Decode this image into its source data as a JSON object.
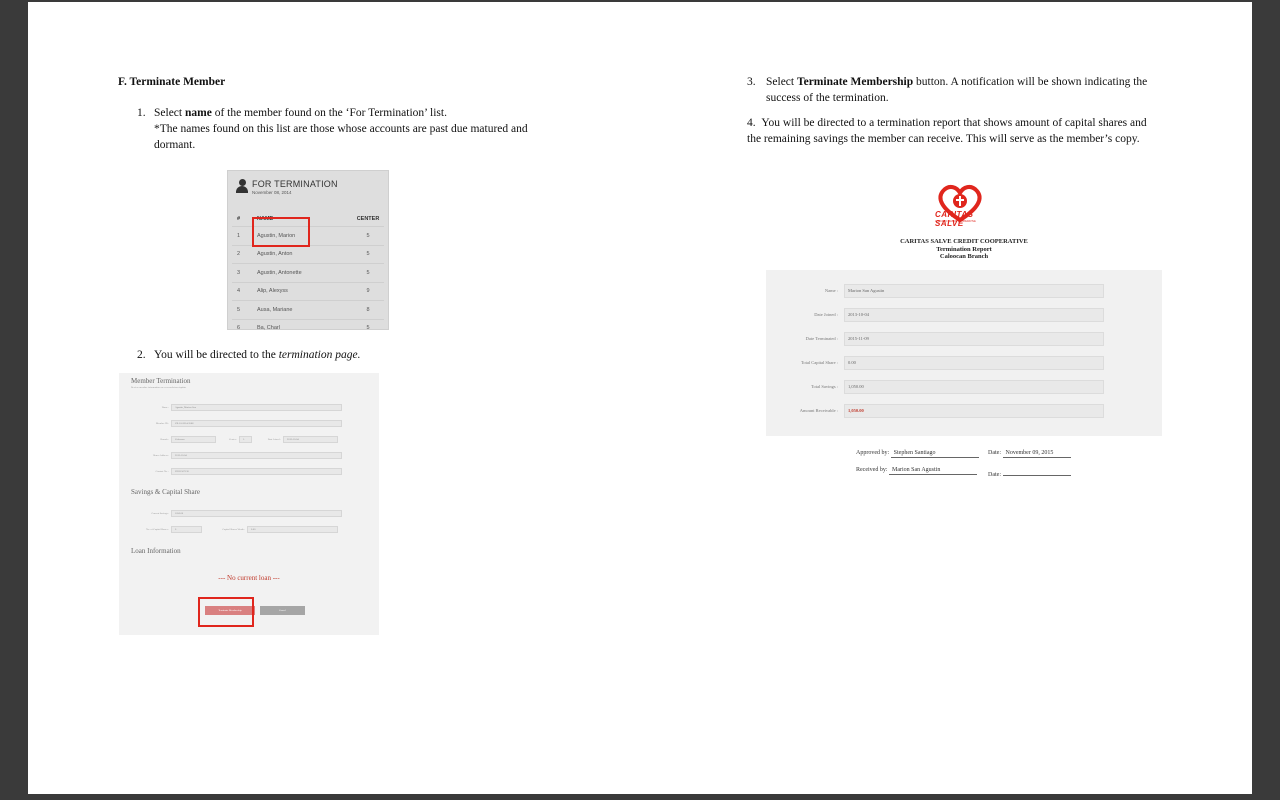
{
  "doc": {
    "section_title": "F. Terminate Member",
    "step1_prefix": "Select ",
    "step1_bold": "name",
    "step1_rest": " of the member found on the ‘For Termination’ list.",
    "step1_note": "*The names found on this list are those whose accounts are past due matured and dormant.",
    "step2_prefix": "You will be directed to the ",
    "step2_italic": "termination page.",
    "step3_prefix": "Select ",
    "step3_bold": "Terminate Membership",
    "step3_rest": " button. A notification will be shown indicating the success of the termination.",
    "step4": "You will be directed to a termination report that shows amount of capital shares and the remaining savings the member can receive. This will serve as the member’s copy.",
    "num1": "1.",
    "num2": "2.",
    "num3": "3.",
    "num4": "4."
  },
  "for_termination": {
    "title": "FOR TERMINATION",
    "date": "November 08, 2014",
    "headers": [
      "#",
      "NAME",
      "CENTER"
    ],
    "rows": [
      [
        "1",
        "Agustin, Marion",
        "5"
      ],
      [
        "2",
        "Agustin, Anton",
        "5"
      ],
      [
        "3",
        "Agustin, Antonette",
        "5"
      ],
      [
        "4",
        "Alip, Alexyss",
        "9"
      ],
      [
        "5",
        "Ausa, Mariane",
        "8"
      ],
      [
        "6",
        "Ba, Charl",
        "5"
      ]
    ]
  },
  "member_termination": {
    "title": "Member Termination",
    "subtitle": "Review member information on or records/save/update",
    "fields": [
      {
        "label": "Name :",
        "value": "Agustin, Marion Son"
      },
      {
        "label": "Member ID :",
        "value": "CR-10-2014-3568"
      },
      {
        "label": "Branch :",
        "value": "Caloocan"
      },
      {
        "label": "Center :",
        "value": "5"
      },
      {
        "label": "Date Joined :",
        "value": "2013-10-04"
      },
      {
        "label": "Home Address :",
        "value": "2013-10-04"
      },
      {
        "label": "Contact No. :",
        "value": "09321507130"
      }
    ],
    "savings_title": "Savings & Capital Share",
    "savings_fields": [
      {
        "label": "Current Savings :",
        "value": "1050.00"
      },
      {
        "label": "No. of Capital Shares :",
        "value": "0"
      },
      {
        "label": "Capital Shares Worth :",
        "value": "0.00"
      }
    ],
    "loan_title": "Loan Information",
    "no_loan": "--- No current loan ---",
    "terminate_btn": "Terminate Membership",
    "cancel_btn": "Cancel"
  },
  "report": {
    "logo_text": "CARITAS SALVE",
    "logo_sub": "A MICRO FINANCE COOPERATIVE",
    "org": "CARITAS SALVE CREDIT COOPERATIVE",
    "doc_title": "Termination Report",
    "branch": "Caloocan Branch",
    "rows": [
      {
        "label": "Name :",
        "value": "Marion San Agustin"
      },
      {
        "label": "Date Joined :",
        "value": "2013-10-04"
      },
      {
        "label": "Date Terminated :",
        "value": "2015-11-09"
      },
      {
        "label": "Total Capital Share :",
        "value": "0.00"
      },
      {
        "label": "Total Savings :",
        "value": "1,050.00"
      },
      {
        "label": "Amount Receivable :",
        "value": "1,050.00"
      }
    ],
    "approved_label": "Approved by:",
    "approved_name": "Stephen Santiago",
    "date_label": "Date:",
    "approved_date": "November 09, 2015",
    "received_label": "Received by:",
    "received_name": "Marion San Agustin",
    "received_date_label": "Date:"
  },
  "colors": {
    "highlight": "#e0261d",
    "page": "#ffffff",
    "frame": "#3a3a3a"
  }
}
